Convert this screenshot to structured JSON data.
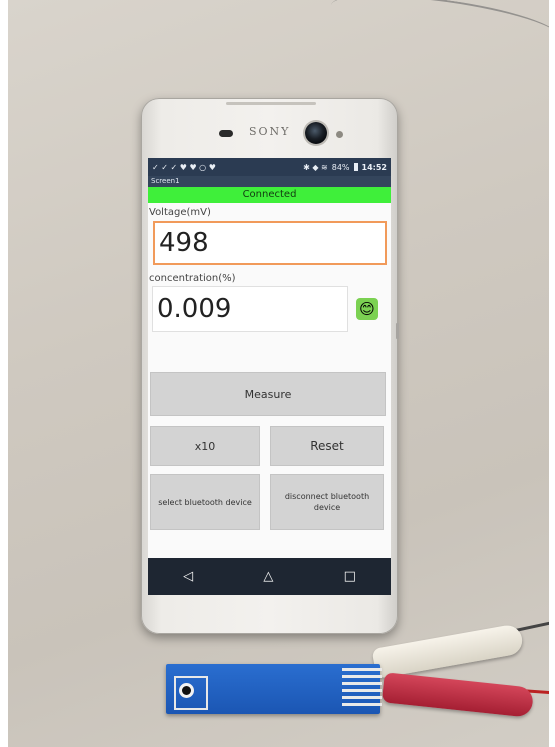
{
  "phone": {
    "brand": "SONY"
  },
  "status_bar": {
    "left_icons": "✓ ✓ ✓ ♥ ♥ ○ ♥",
    "right_icons": "✱ ◆ ≋",
    "battery": "84%",
    "time": "14:52"
  },
  "app": {
    "title": "Screen1",
    "connection_status": "Connected",
    "voltage_label": "Voltage(mV)",
    "voltage_value": "498",
    "concentration_label": "concentration(%)",
    "concentration_value": "0.009",
    "status_emoji": "😊",
    "buttons": {
      "measure": "Measure",
      "x10": "x10",
      "reset": "Reset",
      "select_bluetooth": "select bluetooth device",
      "disconnect_bluetooth": "disconnect bluetooth device"
    }
  },
  "navbar": {
    "back_icon": "◁",
    "home_icon": "△",
    "recents_icon": "□"
  },
  "colors": {
    "connected_bar": "#3fef3a",
    "voltage_border": "#f19a5a",
    "status_bar": "#2b3b52",
    "button_gray": "#d3d3d3",
    "strip_blue": "#1b56b3"
  }
}
